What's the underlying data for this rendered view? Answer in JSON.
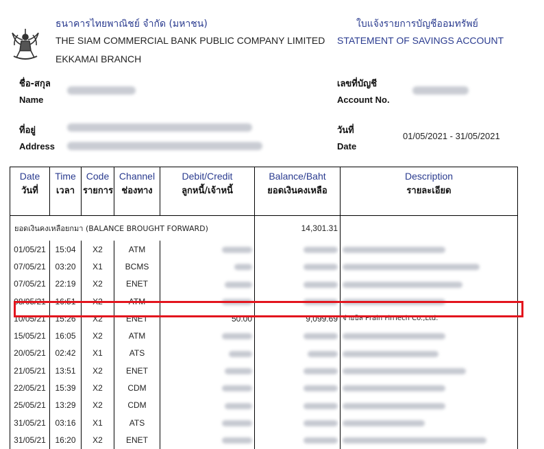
{
  "header": {
    "bank_name_th": "ธนาคารไทยพาณิชย์ จำกัด (มหาชน)",
    "bank_name_en": "THE SIAM COMMERCIAL BANK PUBLIC COMPANY LIMITED",
    "branch": "EKKAMAI BRANCH",
    "statement_title_th": "ใบแจ้งรายการบัญชีออมทรัพย์",
    "statement_title_en": "STATEMENT OF SAVINGS ACCOUNT"
  },
  "account_info": {
    "name_label_th": "ชื่อ-สกุล",
    "name_label_en": "Name",
    "address_label_th": "ที่อยู่",
    "address_label_en": "Address",
    "account_label_th": "เลขที่บัญชี",
    "account_label_en": "Account No.",
    "date_label_th": "วันที่",
    "date_label_en": "Date",
    "period": "01/05/2021 - 31/05/2021"
  },
  "table": {
    "columns": [
      {
        "en": "Date",
        "th": "วันที่"
      },
      {
        "en": "Time",
        "th": "เวลา"
      },
      {
        "en": "Code",
        "th": "รายการ"
      },
      {
        "en": "Channel",
        "th": "ช่องทาง"
      },
      {
        "en": "Debit/Credit",
        "th": "ลูกหนี้/เจ้าหนี้"
      },
      {
        "en": "Balance/Baht",
        "th": "ยอดเงินคงเหลือ"
      },
      {
        "en": "Description",
        "th": "รายละเอียด"
      }
    ],
    "brought_forward_label": "ยอดเงินคงเหลือยกมา (BALANCE BROUGHT FORWARD)",
    "brought_forward_balance": "14,301.31",
    "rows": [
      {
        "date": "01/05/21",
        "time": "15:04",
        "code": "X2",
        "channel": "ATM"
      },
      {
        "date": "07/05/21",
        "time": "03:20",
        "code": "X1",
        "channel": "BCMS"
      },
      {
        "date": "07/05/21",
        "time": "22:19",
        "code": "X2",
        "channel": "ENET"
      },
      {
        "date": "08/05/21",
        "time": "16:51",
        "code": "X2",
        "channel": "ATM"
      },
      {
        "date": "10/05/21",
        "time": "15:26",
        "code": "X2",
        "channel": "ENET",
        "amount": "50.00",
        "balance": "9,099.69",
        "description": "จ่ายบิล Prain FinTech Co.,Ltd."
      },
      {
        "date": "15/05/21",
        "time": "16:05",
        "code": "X2",
        "channel": "ATM"
      },
      {
        "date": "20/05/21",
        "time": "02:42",
        "code": "X1",
        "channel": "ATS"
      },
      {
        "date": "21/05/21",
        "time": "13:51",
        "code": "X2",
        "channel": "ENET"
      },
      {
        "date": "22/05/21",
        "time": "15:39",
        "code": "X2",
        "channel": "CDM"
      },
      {
        "date": "25/05/21",
        "time": "13:29",
        "code": "X2",
        "channel": "CDM"
      },
      {
        "date": "31/05/21",
        "time": "03:16",
        "code": "X1",
        "channel": "ATS"
      },
      {
        "date": "31/05/21",
        "time": "16:20",
        "code": "X2",
        "channel": "ENET"
      }
    ]
  },
  "colors": {
    "header_blue": "#2a3b8f",
    "highlight_red": "#e3141d"
  },
  "icons": {
    "logo": "garuda-emblem-icon"
  }
}
